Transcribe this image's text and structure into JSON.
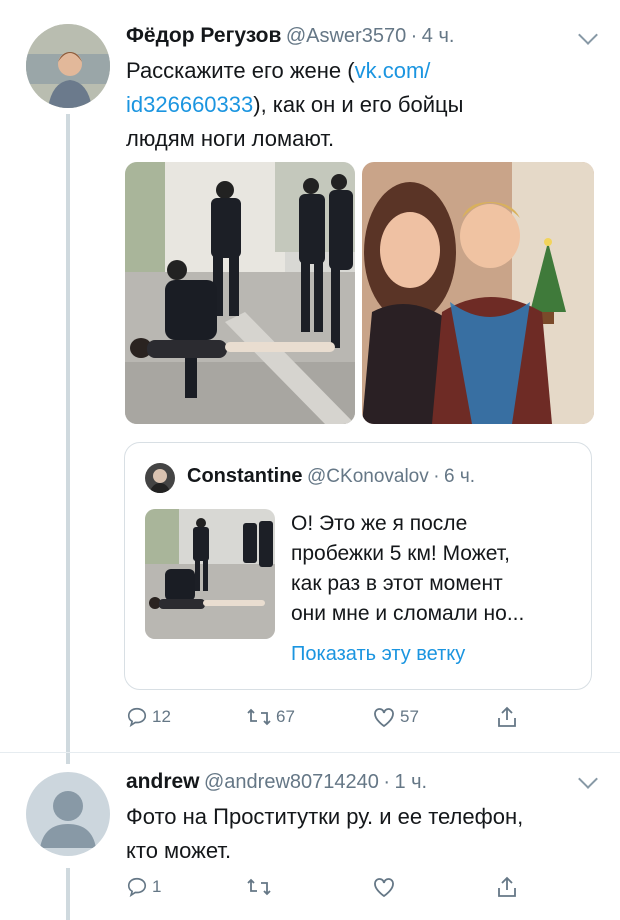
{
  "tweet1": {
    "name": "Фёдор Регузов",
    "handle": "@Aswer3570",
    "time": "4 ч.",
    "text_line1": "Расскажите его жене (",
    "link_line1": "vk.com/",
    "link_line2": "id326660333",
    "text_line2": "), как он и его бойцы",
    "text_line3": "людям ноги ломают.",
    "quote": {
      "name": "Constantine",
      "handle": "@CKonovalov",
      "time": "6 ч.",
      "lines": [
        "О! Это же я после",
        "пробежки 5 км! Может,",
        "как раз в этот момент",
        "они мне и сломали но..."
      ],
      "show_thread": "Показать эту ветку"
    },
    "replies": "12",
    "retweets": "67",
    "likes": "57"
  },
  "tweet2": {
    "name": "andrew",
    "handle": "@andrew80714240",
    "time": "1 ч.",
    "text_line1": "Фото на Проститутки ру. и ее телефон,",
    "text_line2": "кто может.",
    "replies": "1"
  },
  "colors": {
    "accent": "#1b95e0",
    "muted": "#657786",
    "border": "#d8dfe4"
  },
  "icons": [
    "reply-icon",
    "retweet-icon",
    "like-icon",
    "share-icon",
    "chevron-down-icon",
    "default-avatar-icon"
  ]
}
